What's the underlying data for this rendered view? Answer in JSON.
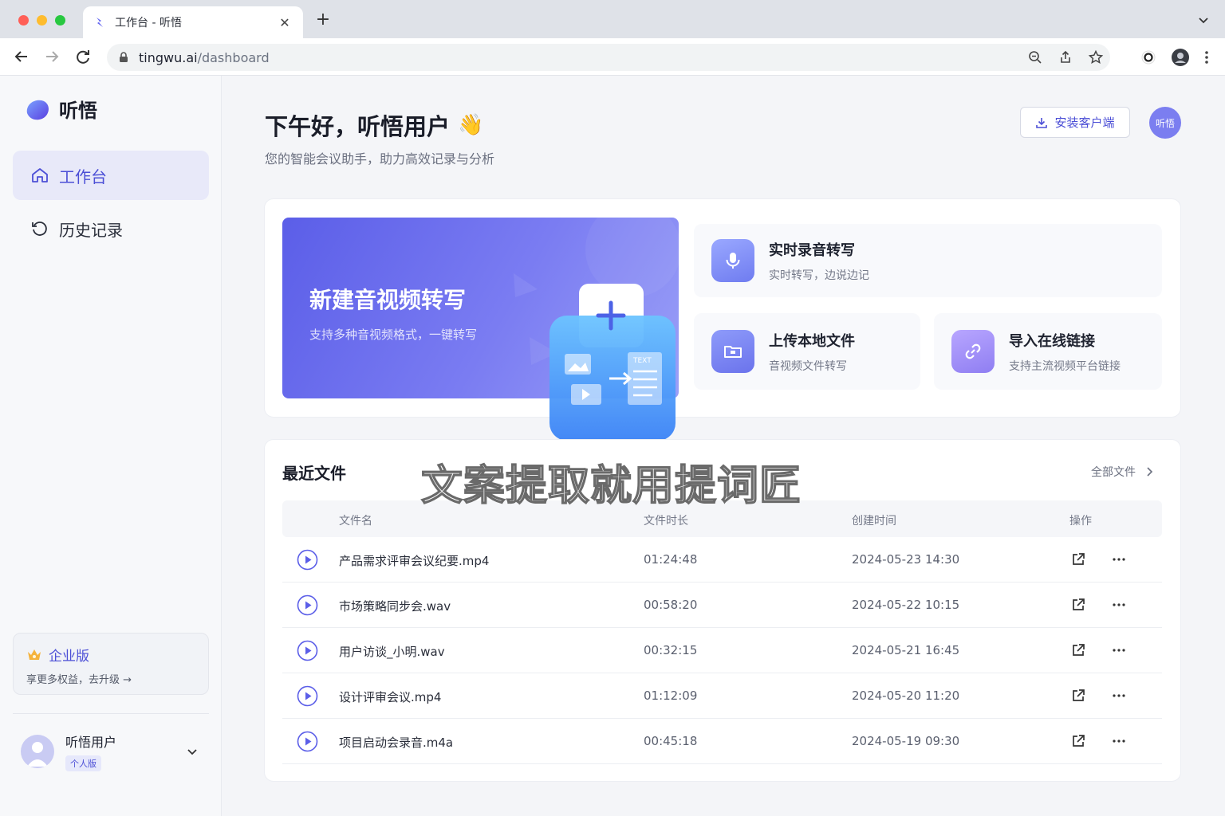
{
  "browser": {
    "tab_title": "工作台 - 听悟",
    "url_host": "tingwu.ai",
    "url_path": "/dashboard"
  },
  "sidebar": {
    "brand": "听悟",
    "items": [
      {
        "label": "工作台",
        "icon": "home-icon",
        "active": true
      },
      {
        "label": "历史记录",
        "icon": "history-icon",
        "active": false
      }
    ],
    "upgrade": {
      "title": "企业版",
      "desc": "享更多权益，去升级 →",
      "icon": "crown-icon"
    },
    "user": {
      "name": "听悟用户",
      "plan": "个人版"
    }
  },
  "header": {
    "greeting": "下午好，听悟用户",
    "wave": "👋",
    "subtitle": "您的智能会议助手，助力高效记录与分析",
    "install_label": "安装客户端",
    "avatar_text": "听悟"
  },
  "hero": {
    "title": "新建音视频转写",
    "desc": "支持多种音视频格式，一键转写",
    "art_text": "TEXT"
  },
  "cards": [
    {
      "title": "实时录音转写",
      "desc": "实时转写，边说边记",
      "icon": "microphone-icon"
    },
    {
      "title": "上传本地文件",
      "desc": "音视频文件转写",
      "icon": "folder-icon"
    },
    {
      "title": "导入在线链接",
      "desc": "支持主流视频平台链接",
      "icon": "link-icon"
    }
  ],
  "files": {
    "title": "最近文件",
    "all_label": "全部文件",
    "watermark": "文案提取就用提词匠",
    "columns": {
      "name": "文件名",
      "duration": "文件时长",
      "created": "创建时间",
      "actions": "操作"
    },
    "rows": [
      {
        "name": "产品需求评审会议纪要.mp4",
        "duration": "01:24:48",
        "created": "2024-05-23 14:30"
      },
      {
        "name": "市场策略同步会.wav",
        "duration": "00:58:20",
        "created": "2024-05-22 10:15"
      },
      {
        "name": "用户访谈_小明.wav",
        "duration": "00:32:15",
        "created": "2024-05-21 16:45"
      },
      {
        "name": "设计评审会议.mp4",
        "duration": "01:12:09",
        "created": "2024-05-20 11:20"
      },
      {
        "name": "项目启动会录音.m4a",
        "duration": "00:45:18",
        "created": "2024-05-19 09:30"
      }
    ]
  },
  "colors": {
    "accent": "#4c4fd6",
    "hero_start": "#5b5ee8",
    "hero_end": "#9a9ff7"
  }
}
